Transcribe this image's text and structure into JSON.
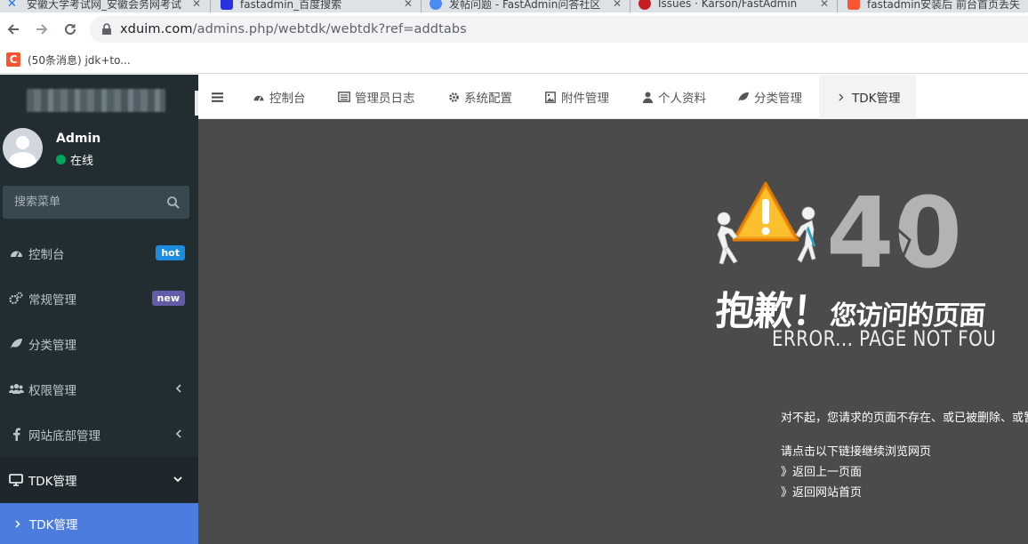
{
  "browser": {
    "tabs": [
      {
        "title": "安徽大学考试网_安徽会务网考试",
        "favicon_color": "#1a73e8"
      },
      {
        "title": "fastadmin_百度搜索",
        "favicon_color": "#2932e1"
      },
      {
        "title": "发帖问题 - FastAdmin问答社区",
        "favicon_color": "#4a8af4"
      },
      {
        "title": "Issues · Karson/FastAdmin",
        "favicon_color": "#c71d23"
      },
      {
        "title": "fastadmin安装后 前台首页丢失",
        "favicon_color": "#fc5531"
      }
    ],
    "url_host": "xduim.com",
    "url_path": "/admins.php/webtdk/webtdk?ref=addtabs",
    "bookmarks": [
      {
        "label": "(50条消息) jdk+to...",
        "icon_letter": "C",
        "icon_color": "#fc5531"
      }
    ]
  },
  "sidebar": {
    "user": {
      "name": "Admin",
      "status": "在线",
      "status_color": "#00a65a"
    },
    "search_placeholder": "搜索菜单",
    "menu": [
      {
        "label": "控制台",
        "icon": "dashboard-icon",
        "badge": "hot",
        "badge_color": "#3c8dbc"
      },
      {
        "label": "常规管理",
        "icon": "cogs-icon",
        "badge": "new",
        "badge_color": "#605ca8"
      },
      {
        "label": "分类管理",
        "icon": "leaf-icon"
      },
      {
        "label": "权限管理",
        "icon": "group-icon",
        "chevron": "left"
      },
      {
        "label": "网站底部管理",
        "icon": "facebook-icon",
        "chevron": "left"
      },
      {
        "label": "TDK管理",
        "icon": "desktop-icon",
        "chevron": "down",
        "open": true
      }
    ],
    "submenu": [
      {
        "label": "TDK管理",
        "active": true
      }
    ]
  },
  "topnav": {
    "tabs": [
      {
        "label": "控制台",
        "icon": "dashboard-icon"
      },
      {
        "label": "管理员日志",
        "icon": "list-alt-icon"
      },
      {
        "label": "系统配置",
        "icon": "cog-icon"
      },
      {
        "label": "附件管理",
        "icon": "image-icon"
      },
      {
        "label": "个人资料",
        "icon": "user-icon"
      },
      {
        "label": "分类管理",
        "icon": "leaf-icon"
      },
      {
        "label": "TDK管理",
        "icon": "chevron-right-icon",
        "active": true
      }
    ]
  },
  "error_page": {
    "code_visible": "40",
    "title_big": "抱歉！",
    "title_small": "您访问的页面",
    "subtitle": "ERROR... PAGE NOT FOU",
    "message": "对不起，您请求的页面不存在、或已被删除、或暂",
    "prompt": "请点击以下链接继续浏览网页",
    "links": [
      "》返回上一页面",
      "》返回网站首页"
    ]
  },
  "colors": {
    "sidebar_bg": "#222d32",
    "content_bg": "#4b4b4b",
    "active_submenu": "#4d7cdf"
  }
}
